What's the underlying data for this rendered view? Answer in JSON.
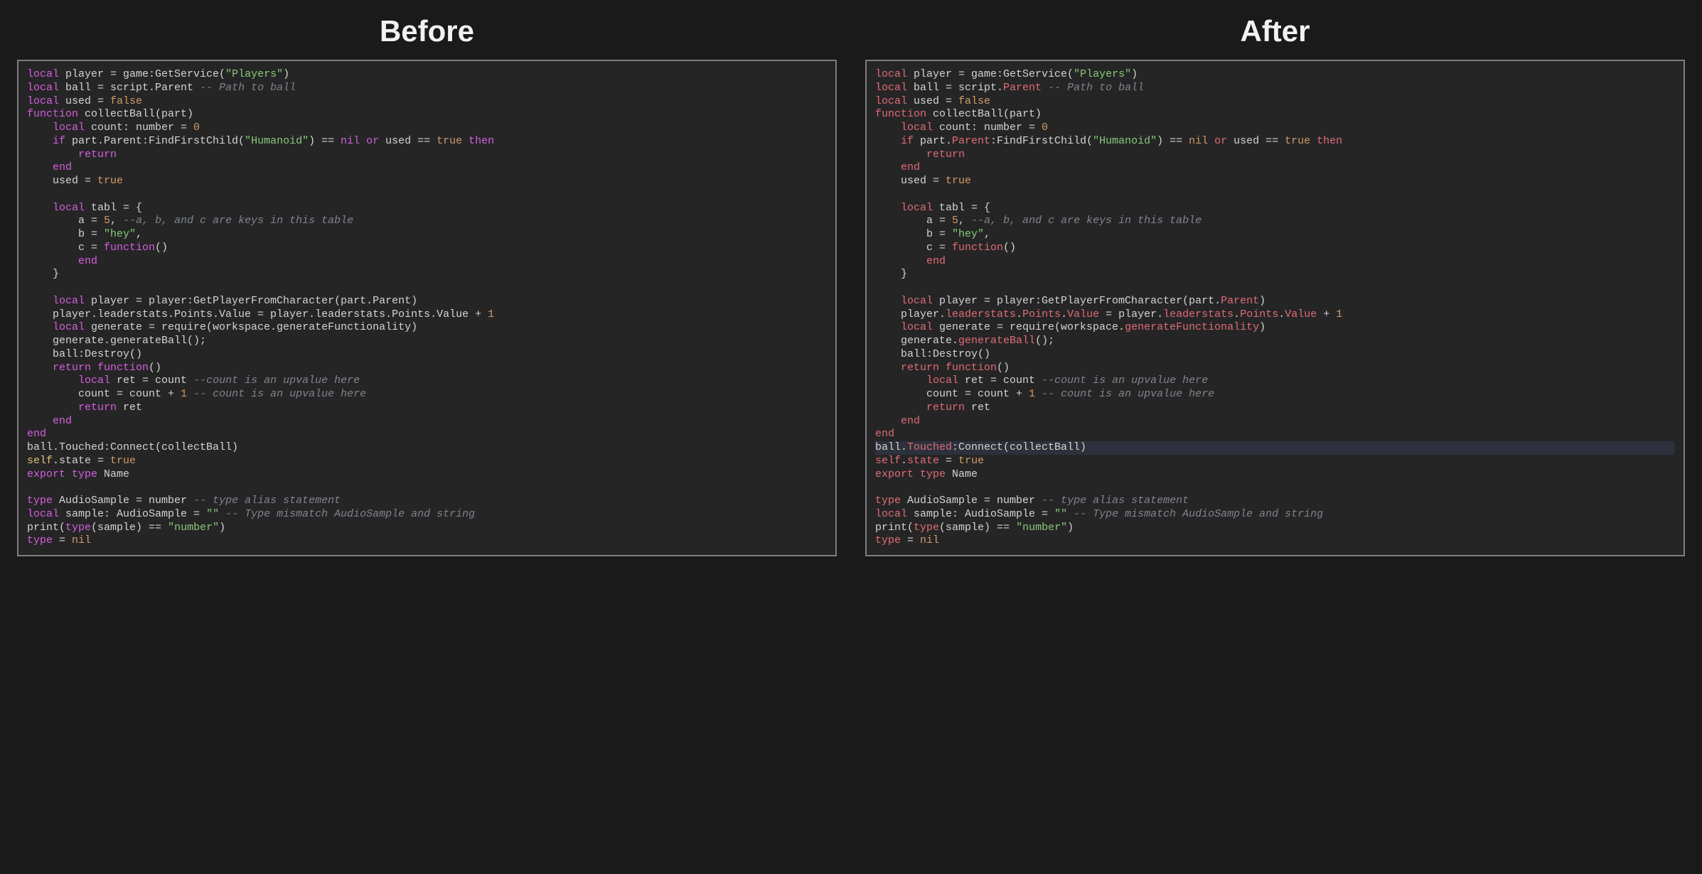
{
  "headings": {
    "before": "Before",
    "after": "After"
  },
  "before": {
    "l01a": "local",
    "l01b": " player = game:GetService(",
    "l01s": "\"Players\"",
    "l01c": ")",
    "l02a": "local",
    "l02b": " ball = script.Parent ",
    "l02c": "-- Path to ball",
    "l03a": "local",
    "l03b": " used = ",
    "l03c": "false",
    "l04a": "function",
    "l04b": " collectBall(part)",
    "l05a": "    local",
    "l05b": " count: number = ",
    "l05c": "0",
    "l06a": "    if",
    "l06b": " part.Parent:FindFirstChild(",
    "l06s": "\"Humanoid\"",
    "l06c": ") == ",
    "l06d": "nil",
    "l06e": " or",
    "l06f": " used == ",
    "l06g": "true",
    "l06h": " then",
    "l07a": "        return",
    "l08a": "    end",
    "l09a": "    used = ",
    "l09b": "true",
    "blank1": "",
    "l10a": "    local",
    "l10b": " tabl = {",
    "l11a": "        a = ",
    "l11b": "5",
    "l11c": ", ",
    "l11d": "--a, b, and c are keys in this table",
    "l12a": "        b = ",
    "l12b": "\"hey\"",
    "l12c": ",",
    "l13a": "        c = ",
    "l13b": "function",
    "l13c": "()",
    "l14a": "        end",
    "l15a": "    }",
    "blank2": "",
    "l16a": "    local",
    "l16b": " player = player:GetPlayerFromCharacter(part.Parent)",
    "l17a": "    player.leaderstats.Points.Value = player.leaderstats.Points.Value + ",
    "l17b": "1",
    "l18a": "    local",
    "l18b": " generate = require(workspace.generateFunctionality)",
    "l19a": "    generate.generateBall();",
    "l20a": "    ball:Destroy()",
    "l21a": "    return",
    "l21b": " function",
    "l21c": "()",
    "l22a": "        local",
    "l22b": " ret = count ",
    "l22c": "--count is an upvalue here",
    "l23a": "        count = count + ",
    "l23b": "1",
    "l23c": " -- count is an upvalue here",
    "l24a": "        return",
    "l24b": " ret",
    "l25a": "    end",
    "l26a": "end",
    "l27a": "ball.Touched:Connect(collectBall)",
    "l28a": "self",
    "l28b": ".state = ",
    "l28c": "true",
    "l29a": "export",
    "l29b": " type",
    "l29c": " Name",
    "blank3": "",
    "l30a": "type",
    "l30b": " AudioSample = number ",
    "l30c": "-- type alias statement",
    "l31a": "local",
    "l31b": " sample: AudioSample = ",
    "l31s": "\"\"",
    "l31c": " -- Type mismatch AudioSample and string",
    "l32a": "print(",
    "l32b": "type",
    "l32c": "(sample) == ",
    "l32s": "\"number\"",
    "l32d": ")",
    "l33a": "type",
    "l33b": " = ",
    "l33c": "nil"
  },
  "after": {
    "l01a": "local",
    "l01b": " player = game:GetService(",
    "l01s": "\"Players\"",
    "l01c": ")",
    "l02a": "local",
    "l02b": " ball = script.",
    "l02p": "Parent",
    "l02c": " -- Path to ball",
    "l03a": "local",
    "l03b": " used = ",
    "l03c": "false",
    "l04a": "function",
    "l04b": " collectBall(part)",
    "l05a": "    local",
    "l05b": " count: number = ",
    "l05c": "0",
    "l06a": "    if",
    "l06b": " part.",
    "l06p": "Parent",
    "l06c": ":FindFirstChild(",
    "l06s": "\"Humanoid\"",
    "l06d": ") == ",
    "l06e": "nil",
    "l06f": " or",
    "l06g": " used == ",
    "l06h": "true",
    "l06i": " then",
    "l07a": "        return",
    "l08a": "    end",
    "l09a": "    used = ",
    "l09b": "true",
    "blank1": "",
    "l10a": "    local",
    "l10b": " tabl = {",
    "l11a": "        a = ",
    "l11b": "5",
    "l11c": ", ",
    "l11d": "--a, b, and c are keys in this table",
    "l12a": "        b = ",
    "l12b": "\"hey\"",
    "l12c": ",",
    "l13a": "        c = ",
    "l13b": "function",
    "l13c": "()",
    "l14a": "        end",
    "l15a": "    }",
    "blank2": "",
    "l16a": "    local",
    "l16b": " player = player:GetPlayerFromCharacter(part.",
    "l16p": "Parent",
    "l16c": ")",
    "l17a": "    player.",
    "l17p1": "leaderstats",
    "l17b": ".",
    "l17p2": "Points",
    "l17c": ".",
    "l17p3": "Value",
    "l17d": " = player.",
    "l17p4": "leaderstats",
    "l17e": ".",
    "l17p5": "Points",
    "l17f": ".",
    "l17p6": "Value",
    "l17g": " + ",
    "l17h": "1",
    "l18a": "    local",
    "l18b": " generate = require(workspace.",
    "l18p": "generateFunctionality",
    "l18c": ")",
    "l19a": "    generate.",
    "l19p": "generateBall",
    "l19b": "();",
    "l20a": "    ball:Destroy()",
    "l21a": "    return",
    "l21b": " function",
    "l21c": "()",
    "l22a": "        local",
    "l22b": " ret = count ",
    "l22c": "--count is an upvalue here",
    "l23a": "        count = count + ",
    "l23b": "1",
    "l23c": " -- count is an upvalue here",
    "l24a": "        return",
    "l24b": " ret",
    "l25a": "    end",
    "l26a": "end",
    "l27a": "ball.",
    "l27p": "Touched",
    "l27b": ":Connect(collectBall)",
    "l28a": "self",
    "l28b": ".",
    "l28p": "state",
    "l28c": " = ",
    "l28d": "true",
    "l29a": "export",
    "l29b": " type",
    "l29c": " Name",
    "blank3": "",
    "l30a": "type",
    "l30b": " AudioSample = number ",
    "l30c": "-- type alias statement",
    "l31a": "local",
    "l31b": " sample: AudioSample = ",
    "l31s": "\"\"",
    "l31c": " -- Type mismatch AudioSample and string",
    "l32a": "print(",
    "l32b": "type",
    "l32c": "(sample) == ",
    "l32s": "\"number\"",
    "l32d": ")",
    "l33a": "type",
    "l33b": " = ",
    "l33c": "nil"
  }
}
